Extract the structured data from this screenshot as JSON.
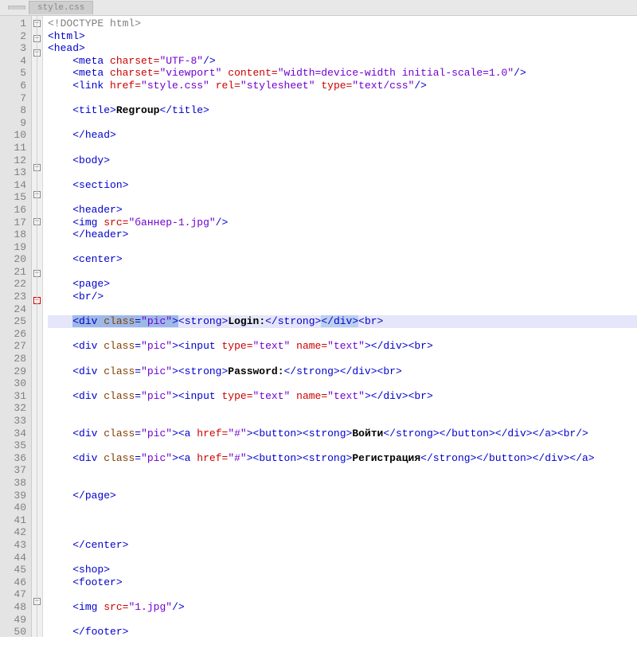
{
  "tabs": [
    "",
    "style.css"
  ],
  "first_line": 1,
  "last_line": 50,
  "highlight_line": 25,
  "fold_markers": {
    "1": "minus",
    "2": "minus",
    "3": "minus",
    "12": "minus",
    "14": "minus",
    "16": "minus",
    "20": "minus",
    "22": "minus-red",
    "46": "minus"
  },
  "code_lines": [
    {
      "n": 1,
      "seg": [
        {
          "c": "t-gray",
          "t": "<!DOCTYPE html>"
        }
      ]
    },
    {
      "n": 2,
      "seg": [
        {
          "c": "t-tag",
          "t": "<html>"
        }
      ]
    },
    {
      "n": 3,
      "seg": [
        {
          "c": "t-tag",
          "t": "<head>"
        }
      ]
    },
    {
      "n": 4,
      "seg": [
        {
          "c": "",
          "t": "    "
        },
        {
          "c": "t-tag",
          "t": "<meta "
        },
        {
          "c": "t-attr",
          "t": "charset="
        },
        {
          "c": "t-str",
          "t": "\"UTF-8\""
        },
        {
          "c": "t-tag",
          "t": "/>"
        }
      ]
    },
    {
      "n": 5,
      "seg": [
        {
          "c": "",
          "t": "    "
        },
        {
          "c": "t-tag",
          "t": "<meta "
        },
        {
          "c": "t-attr",
          "t": "charset="
        },
        {
          "c": "t-str",
          "t": "\"viewport\""
        },
        {
          "c": "",
          "t": " "
        },
        {
          "c": "t-attr",
          "t": "content="
        },
        {
          "c": "t-str",
          "t": "\"width=device-width initial-scale=1.0\""
        },
        {
          "c": "t-tag",
          "t": "/>"
        }
      ]
    },
    {
      "n": 6,
      "seg": [
        {
          "c": "",
          "t": "    "
        },
        {
          "c": "t-tag",
          "t": "<link "
        },
        {
          "c": "t-attr",
          "t": "href="
        },
        {
          "c": "t-str",
          "t": "\"style.css\""
        },
        {
          "c": "",
          "t": " "
        },
        {
          "c": "t-attr",
          "t": "rel="
        },
        {
          "c": "t-str",
          "t": "\"stylesheet\""
        },
        {
          "c": "",
          "t": " "
        },
        {
          "c": "t-attr",
          "t": "type="
        },
        {
          "c": "t-str",
          "t": "\"text/css\""
        },
        {
          "c": "t-tag",
          "t": "/>"
        }
      ]
    },
    {
      "n": 7,
      "seg": [
        {
          "c": "",
          "t": ""
        }
      ]
    },
    {
      "n": 8,
      "seg": [
        {
          "c": "",
          "t": "    "
        },
        {
          "c": "t-tag",
          "t": "<title>"
        },
        {
          "c": "t-txt",
          "t": "Regroup"
        },
        {
          "c": "t-tag",
          "t": "</title>"
        }
      ]
    },
    {
      "n": 9,
      "seg": [
        {
          "c": "",
          "t": ""
        }
      ]
    },
    {
      "n": 10,
      "seg": [
        {
          "c": "",
          "t": "    "
        },
        {
          "c": "t-tag",
          "t": "</head>"
        }
      ]
    },
    {
      "n": 11,
      "seg": [
        {
          "c": "",
          "t": ""
        }
      ]
    },
    {
      "n": 12,
      "seg": [
        {
          "c": "",
          "t": "    "
        },
        {
          "c": "t-tag",
          "t": "<body>"
        }
      ]
    },
    {
      "n": 13,
      "seg": [
        {
          "c": "",
          "t": ""
        }
      ]
    },
    {
      "n": 14,
      "seg": [
        {
          "c": "",
          "t": "    "
        },
        {
          "c": "t-tag",
          "t": "<section>"
        }
      ]
    },
    {
      "n": 15,
      "seg": [
        {
          "c": "",
          "t": ""
        }
      ]
    },
    {
      "n": 16,
      "seg": [
        {
          "c": "",
          "t": "    "
        },
        {
          "c": "t-tag",
          "t": "<header>"
        }
      ]
    },
    {
      "n": 17,
      "seg": [
        {
          "c": "",
          "t": "    "
        },
        {
          "c": "t-tag",
          "t": "<img "
        },
        {
          "c": "t-attr",
          "t": "src="
        },
        {
          "c": "t-str",
          "t": "\"баннер-1.jpg\""
        },
        {
          "c": "t-tag",
          "t": "/>"
        }
      ]
    },
    {
      "n": 18,
      "seg": [
        {
          "c": "",
          "t": "    "
        },
        {
          "c": "t-tag",
          "t": "</header>"
        }
      ]
    },
    {
      "n": 19,
      "seg": [
        {
          "c": "",
          "t": ""
        }
      ]
    },
    {
      "n": 20,
      "seg": [
        {
          "c": "",
          "t": "    "
        },
        {
          "c": "t-tag",
          "t": "<center>"
        }
      ]
    },
    {
      "n": 21,
      "seg": [
        {
          "c": "",
          "t": ""
        }
      ]
    },
    {
      "n": 22,
      "seg": [
        {
          "c": "",
          "t": "    "
        },
        {
          "c": "t-tag",
          "t": "<page>"
        }
      ]
    },
    {
      "n": 23,
      "seg": [
        {
          "c": "",
          "t": "    "
        },
        {
          "c": "t-tag",
          "t": "<br/>"
        }
      ]
    },
    {
      "n": 24,
      "seg": [
        {
          "c": "",
          "t": ""
        }
      ]
    },
    {
      "n": 25,
      "hl": true,
      "seg": [
        {
          "c": "",
          "t": "    "
        },
        {
          "sel": 1,
          "c": "t-tag",
          "t": "<div "
        },
        {
          "sel": 1,
          "c": "t-brown",
          "t": "class"
        },
        {
          "sel": 1,
          "c": "t-tag",
          "t": "="
        },
        {
          "sel": 1,
          "c": "t-str",
          "t": "\"pic\""
        },
        {
          "sel": 1,
          "c": "t-tag",
          "t": ">"
        },
        {
          "c": "t-tag",
          "t": "<strong>"
        },
        {
          "c": "t-txt",
          "t": "Login:"
        },
        {
          "c": "t-tag",
          "t": "</strong>"
        },
        {
          "sel": 2,
          "c": "t-tag",
          "t": "</div>"
        },
        {
          "c": "t-tag",
          "t": "<br>"
        }
      ]
    },
    {
      "n": 26,
      "seg": [
        {
          "c": "",
          "t": ""
        }
      ]
    },
    {
      "n": 27,
      "seg": [
        {
          "c": "",
          "t": "    "
        },
        {
          "c": "t-tag",
          "t": "<div "
        },
        {
          "c": "t-brown",
          "t": "class"
        },
        {
          "c": "t-tag",
          "t": "="
        },
        {
          "c": "t-str",
          "t": "\"pic\""
        },
        {
          "c": "t-tag",
          "t": "><input "
        },
        {
          "c": "t-attr",
          "t": "type="
        },
        {
          "c": "t-str",
          "t": "\"text\""
        },
        {
          "c": "",
          "t": " "
        },
        {
          "c": "t-attr",
          "t": "name="
        },
        {
          "c": "t-str",
          "t": "\"text\""
        },
        {
          "c": "t-tag",
          "t": "></div><br>"
        }
      ]
    },
    {
      "n": 28,
      "seg": [
        {
          "c": "",
          "t": ""
        }
      ]
    },
    {
      "n": 29,
      "seg": [
        {
          "c": "",
          "t": "    "
        },
        {
          "c": "t-tag",
          "t": "<div "
        },
        {
          "c": "t-brown",
          "t": "class"
        },
        {
          "c": "t-tag",
          "t": "="
        },
        {
          "c": "t-str",
          "t": "\"pic\""
        },
        {
          "c": "t-tag",
          "t": "><strong>"
        },
        {
          "c": "t-txt",
          "t": "Password:"
        },
        {
          "c": "t-tag",
          "t": "</strong></div><br>"
        }
      ]
    },
    {
      "n": 30,
      "seg": [
        {
          "c": "",
          "t": ""
        }
      ]
    },
    {
      "n": 31,
      "seg": [
        {
          "c": "",
          "t": "    "
        },
        {
          "c": "t-tag",
          "t": "<div "
        },
        {
          "c": "t-brown",
          "t": "class"
        },
        {
          "c": "t-tag",
          "t": "="
        },
        {
          "c": "t-str",
          "t": "\"pic\""
        },
        {
          "c": "t-tag",
          "t": "><input "
        },
        {
          "c": "t-attr",
          "t": "type="
        },
        {
          "c": "t-str",
          "t": "\"text\""
        },
        {
          "c": "",
          "t": " "
        },
        {
          "c": "t-attr",
          "t": "name="
        },
        {
          "c": "t-str",
          "t": "\"text\""
        },
        {
          "c": "t-tag",
          "t": "></div><br>"
        }
      ]
    },
    {
      "n": 32,
      "seg": [
        {
          "c": "",
          "t": ""
        }
      ]
    },
    {
      "n": 33,
      "seg": [
        {
          "c": "",
          "t": ""
        }
      ]
    },
    {
      "n": 34,
      "seg": [
        {
          "c": "",
          "t": "    "
        },
        {
          "c": "t-tag",
          "t": "<div "
        },
        {
          "c": "t-brown",
          "t": "class"
        },
        {
          "c": "t-tag",
          "t": "="
        },
        {
          "c": "t-str",
          "t": "\"pic\""
        },
        {
          "c": "t-tag",
          "t": "><a "
        },
        {
          "c": "t-attr",
          "t": "href="
        },
        {
          "c": "t-str",
          "t": "\"#\""
        },
        {
          "c": "t-tag",
          "t": "><button><strong>"
        },
        {
          "c": "t-txt",
          "t": "Войти"
        },
        {
          "c": "t-tag",
          "t": "</strong></button></div></a><br/>"
        }
      ]
    },
    {
      "n": 35,
      "seg": [
        {
          "c": "",
          "t": ""
        }
      ]
    },
    {
      "n": 36,
      "seg": [
        {
          "c": "",
          "t": "    "
        },
        {
          "c": "t-tag",
          "t": "<div "
        },
        {
          "c": "t-brown",
          "t": "class"
        },
        {
          "c": "t-tag",
          "t": "="
        },
        {
          "c": "t-str",
          "t": "\"pic\""
        },
        {
          "c": "t-tag",
          "t": "><a "
        },
        {
          "c": "t-attr",
          "t": "href="
        },
        {
          "c": "t-str",
          "t": "\"#\""
        },
        {
          "c": "t-tag",
          "t": "><button><strong>"
        },
        {
          "c": "t-txt",
          "t": "Регистрация"
        },
        {
          "c": "t-tag",
          "t": "</strong></button></div></a>"
        }
      ]
    },
    {
      "n": 37,
      "seg": [
        {
          "c": "",
          "t": ""
        }
      ]
    },
    {
      "n": 38,
      "seg": [
        {
          "c": "",
          "t": ""
        }
      ]
    },
    {
      "n": 39,
      "seg": [
        {
          "c": "",
          "t": "    "
        },
        {
          "c": "t-tag",
          "t": "</page>"
        }
      ]
    },
    {
      "n": 40,
      "seg": [
        {
          "c": "",
          "t": ""
        }
      ]
    },
    {
      "n": 41,
      "seg": [
        {
          "c": "",
          "t": ""
        }
      ]
    },
    {
      "n": 42,
      "seg": [
        {
          "c": "",
          "t": ""
        }
      ]
    },
    {
      "n": 43,
      "seg": [
        {
          "c": "",
          "t": "    "
        },
        {
          "c": "t-tag",
          "t": "</center>"
        }
      ]
    },
    {
      "n": 44,
      "seg": [
        {
          "c": "",
          "t": ""
        }
      ]
    },
    {
      "n": 45,
      "seg": [
        {
          "c": "",
          "t": "    "
        },
        {
          "c": "t-tag",
          "t": "<shop>"
        }
      ]
    },
    {
      "n": 46,
      "seg": [
        {
          "c": "",
          "t": "    "
        },
        {
          "c": "t-tag",
          "t": "<footer>"
        }
      ]
    },
    {
      "n": 47,
      "seg": [
        {
          "c": "",
          "t": ""
        }
      ]
    },
    {
      "n": 48,
      "seg": [
        {
          "c": "",
          "t": "    "
        },
        {
          "c": "t-tag",
          "t": "<img "
        },
        {
          "c": "t-attr",
          "t": "src="
        },
        {
          "c": "t-str",
          "t": "\"1.jpg\""
        },
        {
          "c": "t-tag",
          "t": "/>"
        }
      ]
    },
    {
      "n": 49,
      "seg": [
        {
          "c": "",
          "t": ""
        }
      ]
    },
    {
      "n": 50,
      "seg": [
        {
          "c": "",
          "t": "    "
        },
        {
          "c": "t-tag",
          "t": "</footer>"
        }
      ]
    }
  ]
}
